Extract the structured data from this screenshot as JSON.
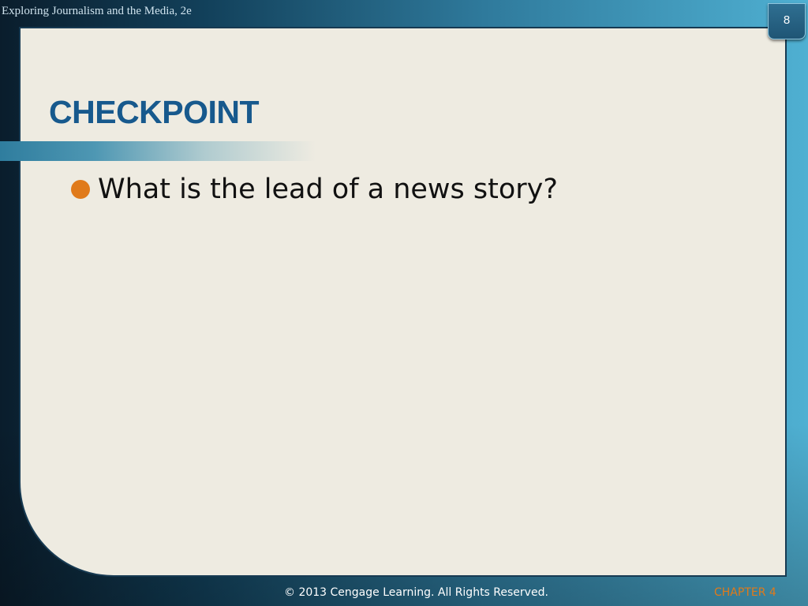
{
  "header": {
    "book_title": "Exploring  Journalism and the Media, 2e",
    "page_number": "8"
  },
  "slide": {
    "title": "CHECKPOINT",
    "bullets": [
      "What is the lead of a news story?"
    ]
  },
  "footer": {
    "copyright": "© 2013 Cengage Learning. All Rights Reserved.",
    "chapter": "CHAPTER 4"
  },
  "colors": {
    "title": "#17598d",
    "bullet": "#e07a1a",
    "chapter": "#e07a1a",
    "panel": "#eeebe1",
    "background_dark": "#0a1d2c",
    "background_light": "#4fb0d2"
  }
}
